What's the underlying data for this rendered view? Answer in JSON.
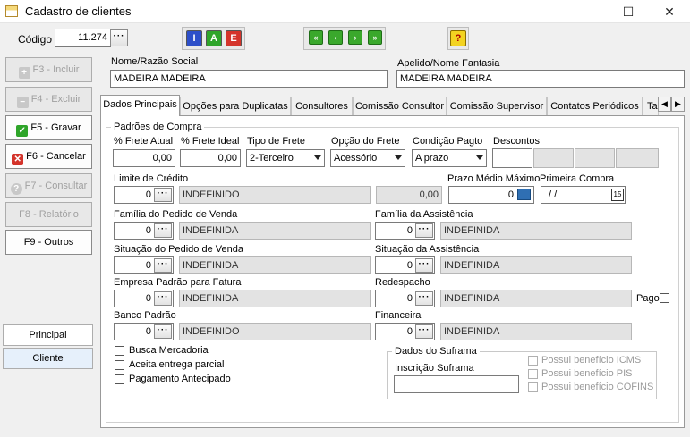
{
  "window": {
    "title": "Cadastro de clientes",
    "min_glyph": "—",
    "max_glyph": "☐",
    "close_glyph": "✕"
  },
  "codigo": {
    "label": "Código",
    "value": "11.274",
    "dots": "···"
  },
  "toolbar": {
    "i": "I",
    "a": "A",
    "e": "E",
    "first": "«",
    "prev": "‹",
    "next": "›",
    "last": "»",
    "help": "?"
  },
  "side": {
    "incluir": "F3 - Incluir",
    "excluir": "F4 - Excluir",
    "gravar": "F5 - Gravar",
    "cancelar": "F6 - Cancelar",
    "consultar": "F7 - Consultar",
    "relatorio": "F8 - Relatório",
    "outros": "F9 - Outros",
    "principal": "Principal",
    "cliente": "Cliente"
  },
  "nome": {
    "label": "Nome/Razão Social",
    "value": "MADEIRA MADEIRA"
  },
  "apelido": {
    "label": "Apelido/Nome Fantasia",
    "value": "MADEIRA MADEIRA"
  },
  "tabs": [
    "Dados Principais",
    "Opções para Duplicatas",
    "Consultores",
    "Comissão Consultor",
    "Comissão Supervisor",
    "Contatos Periódicos",
    "Ta"
  ],
  "padroes": {
    "title": "Padrões de Compra",
    "frete_atual_label": "% Frete Atual",
    "frete_atual": "0,00",
    "frete_ideal_label": "% Frete Ideal",
    "frete_ideal": "0,00",
    "tipo_frete_label": "Tipo de Frete",
    "tipo_frete": "2-Terceiro",
    "opcao_frete_label": "Opção do Frete",
    "opcao_frete": "Acessório",
    "cond_label": "Condição Pagto",
    "cond": "A prazo",
    "descontos_label": "Descontos"
  },
  "limite": {
    "label": "Limite de Crédito",
    "code": "0",
    "desc": "INDEFINIDO",
    "value": "0,00"
  },
  "prazo": {
    "label": "Prazo Médio Máximo",
    "value": "0"
  },
  "primeira": {
    "label": "Primeira Compra",
    "value": "/ /",
    "cal": "15"
  },
  "familia_pedido": {
    "label": "Família do Pedido de Venda",
    "code": "0",
    "desc": "INDEFINIDA"
  },
  "familia_assist": {
    "label": "Família da Assistência",
    "code": "0",
    "desc": "INDEFINIDA"
  },
  "sit_pedido": {
    "label": "Situação do Pedido de Venda",
    "code": "0",
    "desc": "INDEFINIDA"
  },
  "sit_assist": {
    "label": "Situação da Assistência",
    "code": "0",
    "desc": "INDEFINIDA"
  },
  "empresa": {
    "label": "Empresa Padrão para Fatura",
    "code": "0",
    "desc": "INDEFINIDA"
  },
  "redespacho": {
    "label": "Redespacho",
    "code": "0",
    "desc": "INDEFINIDA",
    "pago": "Pago"
  },
  "banco": {
    "label": "Banco Padrão",
    "code": "0",
    "desc": "INDEFINIDO"
  },
  "financeira": {
    "label": "Financeira",
    "code": "0",
    "desc": "INDEFINIDA"
  },
  "checks": {
    "busca": "Busca Mercadoria",
    "aceita": "Aceita entrega parcial",
    "pagamento": "Pagamento Antecipado"
  },
  "suframa": {
    "title": "Dados do Suframa",
    "insc_label": "Inscrição Suframa",
    "icms": "Possui benefício ICMS",
    "pis": "Possui benefício PIS",
    "cofins": "Possui benefício COFINS"
  }
}
